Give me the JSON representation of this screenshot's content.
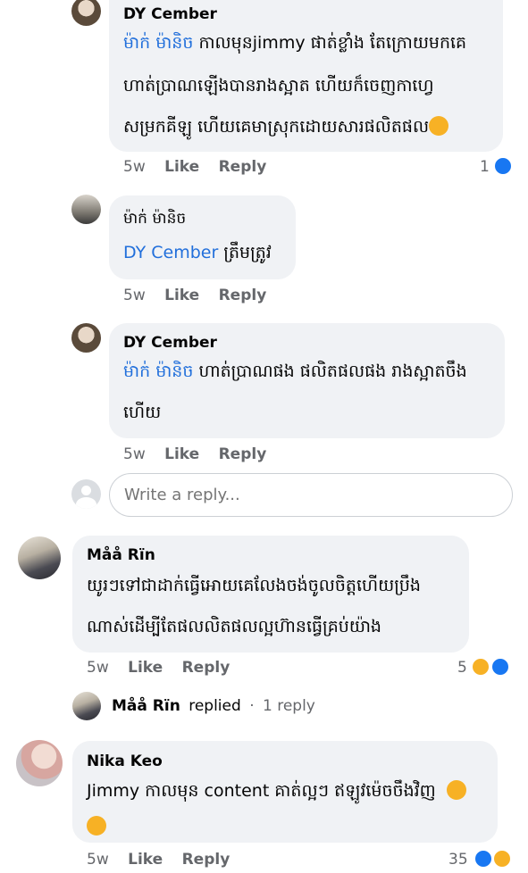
{
  "comments": [
    {
      "author": "DY Cember",
      "mention": "ម៉ាក់ ម៉ានិច",
      "line1": " កាលមុនjimmy ផាត់ខ្លាំង តែក្រោយមកគេ",
      "line2": "ហាត់ប្រាណឡើងបានរាងស្អាត ហើយក៏ចេញកាហ្វេ",
      "line3": "សម្រកគីឡូ ហើយគេមាស្រុកដោយសារផលិតផល",
      "time": "5w",
      "like": "Like",
      "reply": "Reply",
      "reaction_count": "1",
      "reactions": [
        "like-icon"
      ]
    },
    {
      "author": "ម៉ាក់ ម៉ានិច",
      "mention": "DY Cember",
      "line1": " ត្រឹមត្រូវ",
      "time": "5w",
      "like": "Like",
      "reply": "Reply"
    },
    {
      "author": "DY Cember",
      "mention": "ម៉ាក់ ម៉ានិច",
      "line1": " ហាត់ប្រាណផង ផលិតផលផង រាងស្អាតចឹង",
      "line2": "ហើយ",
      "time": "5w",
      "like": "Like",
      "reply": "Reply"
    },
    {
      "author": "Måå Rïn",
      "line1": "យូរៗទៅជាដាក់ធ្វើអោយគេលែងចង់ចូលចិត្តហើយប្រឹង",
      "line2": "ណាស់ដើម្បីតែផលលិតផលល្អហ៊ានធ្វើគ្រប់យ៉ាង",
      "time": "5w",
      "like": "Like",
      "reply": "Reply",
      "reaction_count": "5",
      "reactions": [
        "haha-icon",
        "like-icon"
      ]
    },
    {
      "author": "Nika Keo",
      "line1": "Jimmy កាលមុន content គាត់ល្អៗ ឥឡូវម៉េចចឹងវិញ",
      "time": "5w",
      "like": "Like",
      "reply": "Reply",
      "reaction_count": "35",
      "reactions": [
        "like-icon",
        "sad-icon"
      ]
    }
  ],
  "reply_box": {
    "placeholder": "Write a reply..."
  },
  "replied_row": {
    "name": "Måå Rïn",
    "replied": "replied",
    "dot": "·",
    "count": "1 reply"
  },
  "colors": {
    "bubble": "#f0f2f5",
    "mention": "#216fdb",
    "meta": "#65676b",
    "like_blue": "#1877f2",
    "emoji_yellow": "#f7b125"
  }
}
